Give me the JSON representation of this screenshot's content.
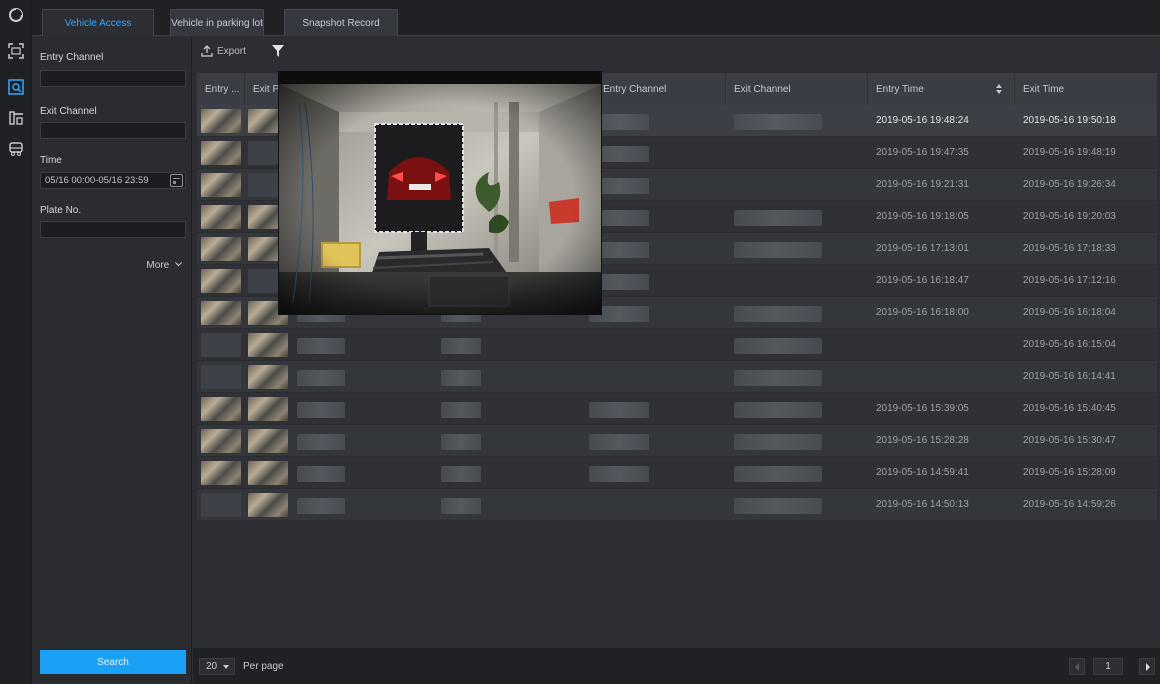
{
  "tabs": [
    {
      "label": "Vehicle Access",
      "active": true
    },
    {
      "label": "Vehicle in parking lot",
      "active": false
    },
    {
      "label": "Snapshot Record",
      "active": false
    }
  ],
  "filter": {
    "entry_channel_label": "Entry Channel",
    "exit_channel_label": "Exit Channel",
    "time_label": "Time",
    "time_value": "05/16 00:00-05/16 23:59",
    "plate_label": "Plate No.",
    "more_label": "More",
    "search_label": "Search"
  },
  "toolbar": {
    "export_label": "Export"
  },
  "table": {
    "columns": [
      "Entry ...",
      "Exit P",
      "Entry Channel",
      "Exit Channel",
      "Entry Time",
      "Exit Time"
    ],
    "rows": [
      {
        "entry_thumb": true,
        "exit_thumb": true,
        "entry_channel": true,
        "exit_channel": true,
        "entry_time": "2019-05-16 19:48:24",
        "exit_time": "2019-05-16 19:50:18",
        "highlight": true
      },
      {
        "entry_thumb": true,
        "exit_thumb": false,
        "entry_channel": true,
        "exit_channel": false,
        "entry_time": "2019-05-16 19:47:35",
        "exit_time": "2019-05-16 19:48:19"
      },
      {
        "entry_thumb": true,
        "exit_thumb": false,
        "entry_channel": true,
        "exit_channel": false,
        "entry_time": "2019-05-16 19:21:31",
        "exit_time": "2019-05-16 19:26:34"
      },
      {
        "entry_thumb": true,
        "exit_thumb": true,
        "entry_channel": true,
        "exit_channel": true,
        "entry_time": "2019-05-16 19:18:05",
        "exit_time": "2019-05-16 19:20:03"
      },
      {
        "entry_thumb": true,
        "exit_thumb": true,
        "entry_channel": true,
        "exit_channel": true,
        "entry_time": "2019-05-16 17:13:01",
        "exit_time": "2019-05-16 17:18:33"
      },
      {
        "entry_thumb": true,
        "exit_thumb": false,
        "entry_channel": true,
        "exit_channel": false,
        "entry_time": "2019-05-16 16:18:47",
        "exit_time": "2019-05-16 17:12:16"
      },
      {
        "entry_thumb": true,
        "exit_thumb": true,
        "entry_channel": true,
        "exit_channel": true,
        "entry_time": "2019-05-16 16:18:00",
        "exit_time": "2019-05-16 16:18:04"
      },
      {
        "entry_thumb": false,
        "exit_thumb": true,
        "entry_channel": false,
        "exit_channel": true,
        "entry_time": "",
        "exit_time": "2019-05-16 16:15:04"
      },
      {
        "entry_thumb": false,
        "exit_thumb": true,
        "entry_channel": false,
        "exit_channel": true,
        "entry_time": "",
        "exit_time": "2019-05-16 16:14:41"
      },
      {
        "entry_thumb": true,
        "exit_thumb": true,
        "entry_channel": true,
        "exit_channel": true,
        "entry_time": "2019-05-16 15:39:05",
        "exit_time": "2019-05-16 15:40:45"
      },
      {
        "entry_thumb": true,
        "exit_thumb": true,
        "entry_channel": true,
        "exit_channel": true,
        "entry_time": "2019-05-16 15:28:28",
        "exit_time": "2019-05-16 15:30:47"
      },
      {
        "entry_thumb": true,
        "exit_thumb": true,
        "entry_channel": true,
        "exit_channel": true,
        "entry_time": "2019-05-16 14:59:41",
        "exit_time": "2019-05-16 15:28:09"
      },
      {
        "entry_thumb": false,
        "exit_thumb": true,
        "entry_channel": false,
        "exit_channel": true,
        "entry_time": "2019-05-16 14:50:13",
        "exit_time": "2019-05-16 14:59:26"
      }
    ]
  },
  "footer": {
    "page_size": "20",
    "per_page_label": "Per page",
    "page": "1"
  },
  "colors": {
    "accent": "#1aa1f5",
    "background": "#2c2e33"
  }
}
